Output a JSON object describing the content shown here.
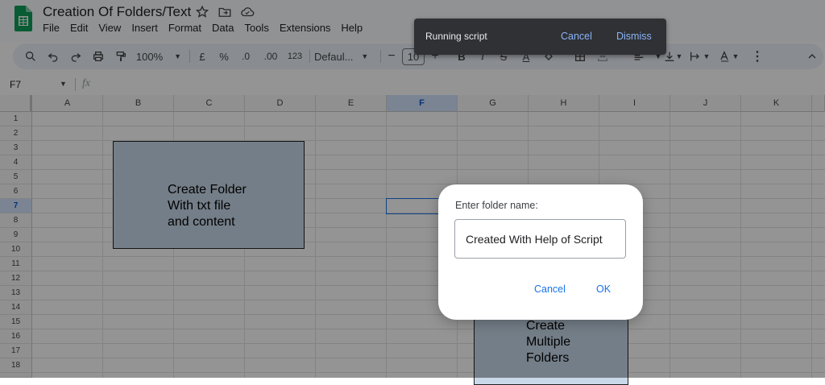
{
  "app": {
    "doc_title": "Creation Of Folders/Text",
    "menu": [
      "File",
      "Edit",
      "View",
      "Insert",
      "Format",
      "Data",
      "Tools",
      "Extensions",
      "Help"
    ]
  },
  "toolbar": {
    "zoom": "100%",
    "currency": "£",
    "percent": "%",
    "decrease_decimal": ".0",
    "increase_decimal": ".00",
    "number_format": "123",
    "font": "Defaul...",
    "font_size": "10",
    "minus": "−",
    "plus": "+"
  },
  "formula_bar": {
    "name_box": "F7",
    "fx": "fx"
  },
  "grid": {
    "columns": [
      "A",
      "B",
      "C",
      "D",
      "E",
      "F",
      "G",
      "H",
      "I",
      "J",
      "K"
    ],
    "rows": [
      "1",
      "2",
      "3",
      "4",
      "5",
      "6",
      "7",
      "8",
      "9",
      "10",
      "11",
      "12",
      "13",
      "14",
      "15",
      "16",
      "17",
      "18"
    ],
    "selected_column": "F",
    "selected_row": "7"
  },
  "shapes": {
    "create_folder": "Create Folder\nWith txt file\nand content",
    "create_multiple": "Create\nMultiple\nFolders"
  },
  "snackbar": {
    "message": "Running script",
    "cancel": "Cancel",
    "dismiss": "Dismiss"
  },
  "dialog": {
    "label": "Enter folder name:",
    "input_value": "Created With Help of Script",
    "cancel": "Cancel",
    "ok": "OK"
  },
  "colors": {
    "sheets_green": "#0f9d58",
    "accent_blue": "#1a73e8",
    "shape_fill": "#c9d9ea",
    "snackbar_bg": "#303134",
    "snackbar_link": "#8ab4f8"
  }
}
